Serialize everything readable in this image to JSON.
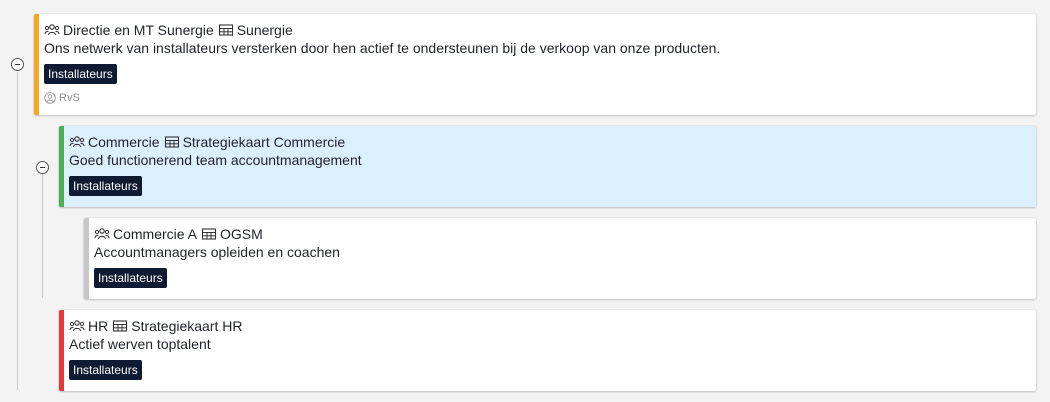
{
  "cards": [
    {
      "team": "Directie en MT Sunergie",
      "map": "Sunergie",
      "goal": "Ons netwerk van installateurs versterken door hen actief te ondersteunen bij de verkoop van onze producten.",
      "tag": "Installateurs",
      "owner": "RvS",
      "accent": "#f5a623"
    },
    {
      "team": "Commercie",
      "map": "Strategiekaart Commercie",
      "goal": "Goed functionerend team accountmanagement",
      "tag": "Installateurs",
      "accent": "#4caf50",
      "selected": true
    },
    {
      "team": "Commercie A",
      "map": "OGSM",
      "goal": "Accountmanagers opleiden en coachen",
      "tag": "Installateurs",
      "accent": "#c7c7c7"
    },
    {
      "team": "HR",
      "map": "Strategiekaart HR",
      "goal": "Actief werven toptalent",
      "tag": "Installateurs",
      "accent": "#e53935"
    }
  ]
}
